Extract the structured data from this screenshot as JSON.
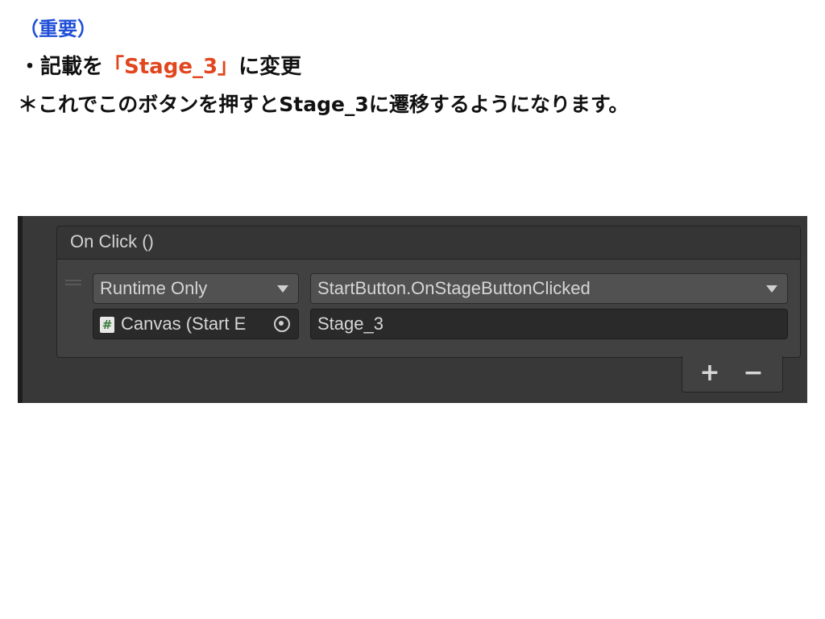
{
  "notes": {
    "heading": "（重要）",
    "instruction_prefix": "・記載を",
    "instruction_value": "「Stage_3」",
    "instruction_suffix": "に変更",
    "remark": "＊これでこのボタンを押すとStage_3に遷移するようになります。"
  },
  "colors": {
    "heading": "#1f4fd8",
    "accent": "#e2461f",
    "panel_bg": "#414141",
    "field_bg": "#515151",
    "input_bg": "#2a2a2a"
  },
  "unity_event": {
    "title": "On Click ()",
    "call_mode": "Runtime Only",
    "function": "StartButton.OnStageButtonClicked",
    "target_object": "Canvas (Start E",
    "target_icon": "csharp-script-icon",
    "argument": "Stage_3",
    "add_label": "+",
    "remove_label": "−"
  }
}
